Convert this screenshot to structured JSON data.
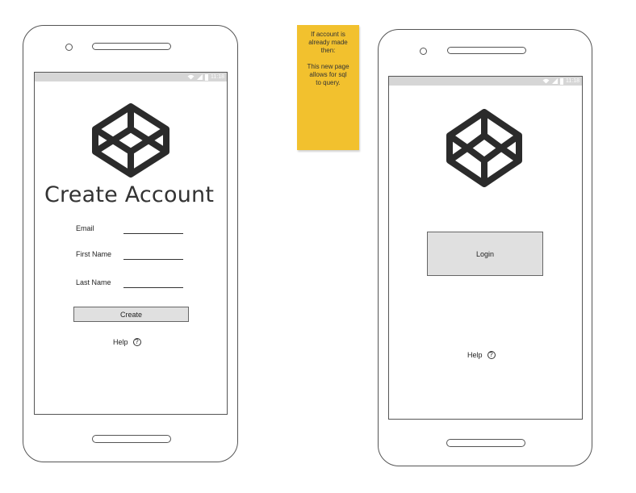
{
  "colors": {
    "outline": "#555555",
    "status_bar": "#d6d6d6",
    "button_fill": "#e0e0e0",
    "sticky_note": "#f2c12e",
    "logo": "#2b2b2b"
  },
  "status_bar": {
    "time": "11:18"
  },
  "create_screen": {
    "logo_icon": "codepen-cube-icon",
    "title": "Create Account",
    "fields": [
      {
        "label": "Email"
      },
      {
        "label": "First Name"
      },
      {
        "label": "Last Name"
      }
    ],
    "create_button": "Create",
    "help_label": "Help",
    "help_icon": "question-circle-icon"
  },
  "sticky_note": {
    "text": "If account is\nalready made\nthen:\n\nThis new page\nallows for sql\nto query."
  },
  "login_screen": {
    "logo_icon": "codepen-cube-icon",
    "login_button": "Login",
    "help_label": "Help",
    "help_icon": "question-circle-icon"
  }
}
